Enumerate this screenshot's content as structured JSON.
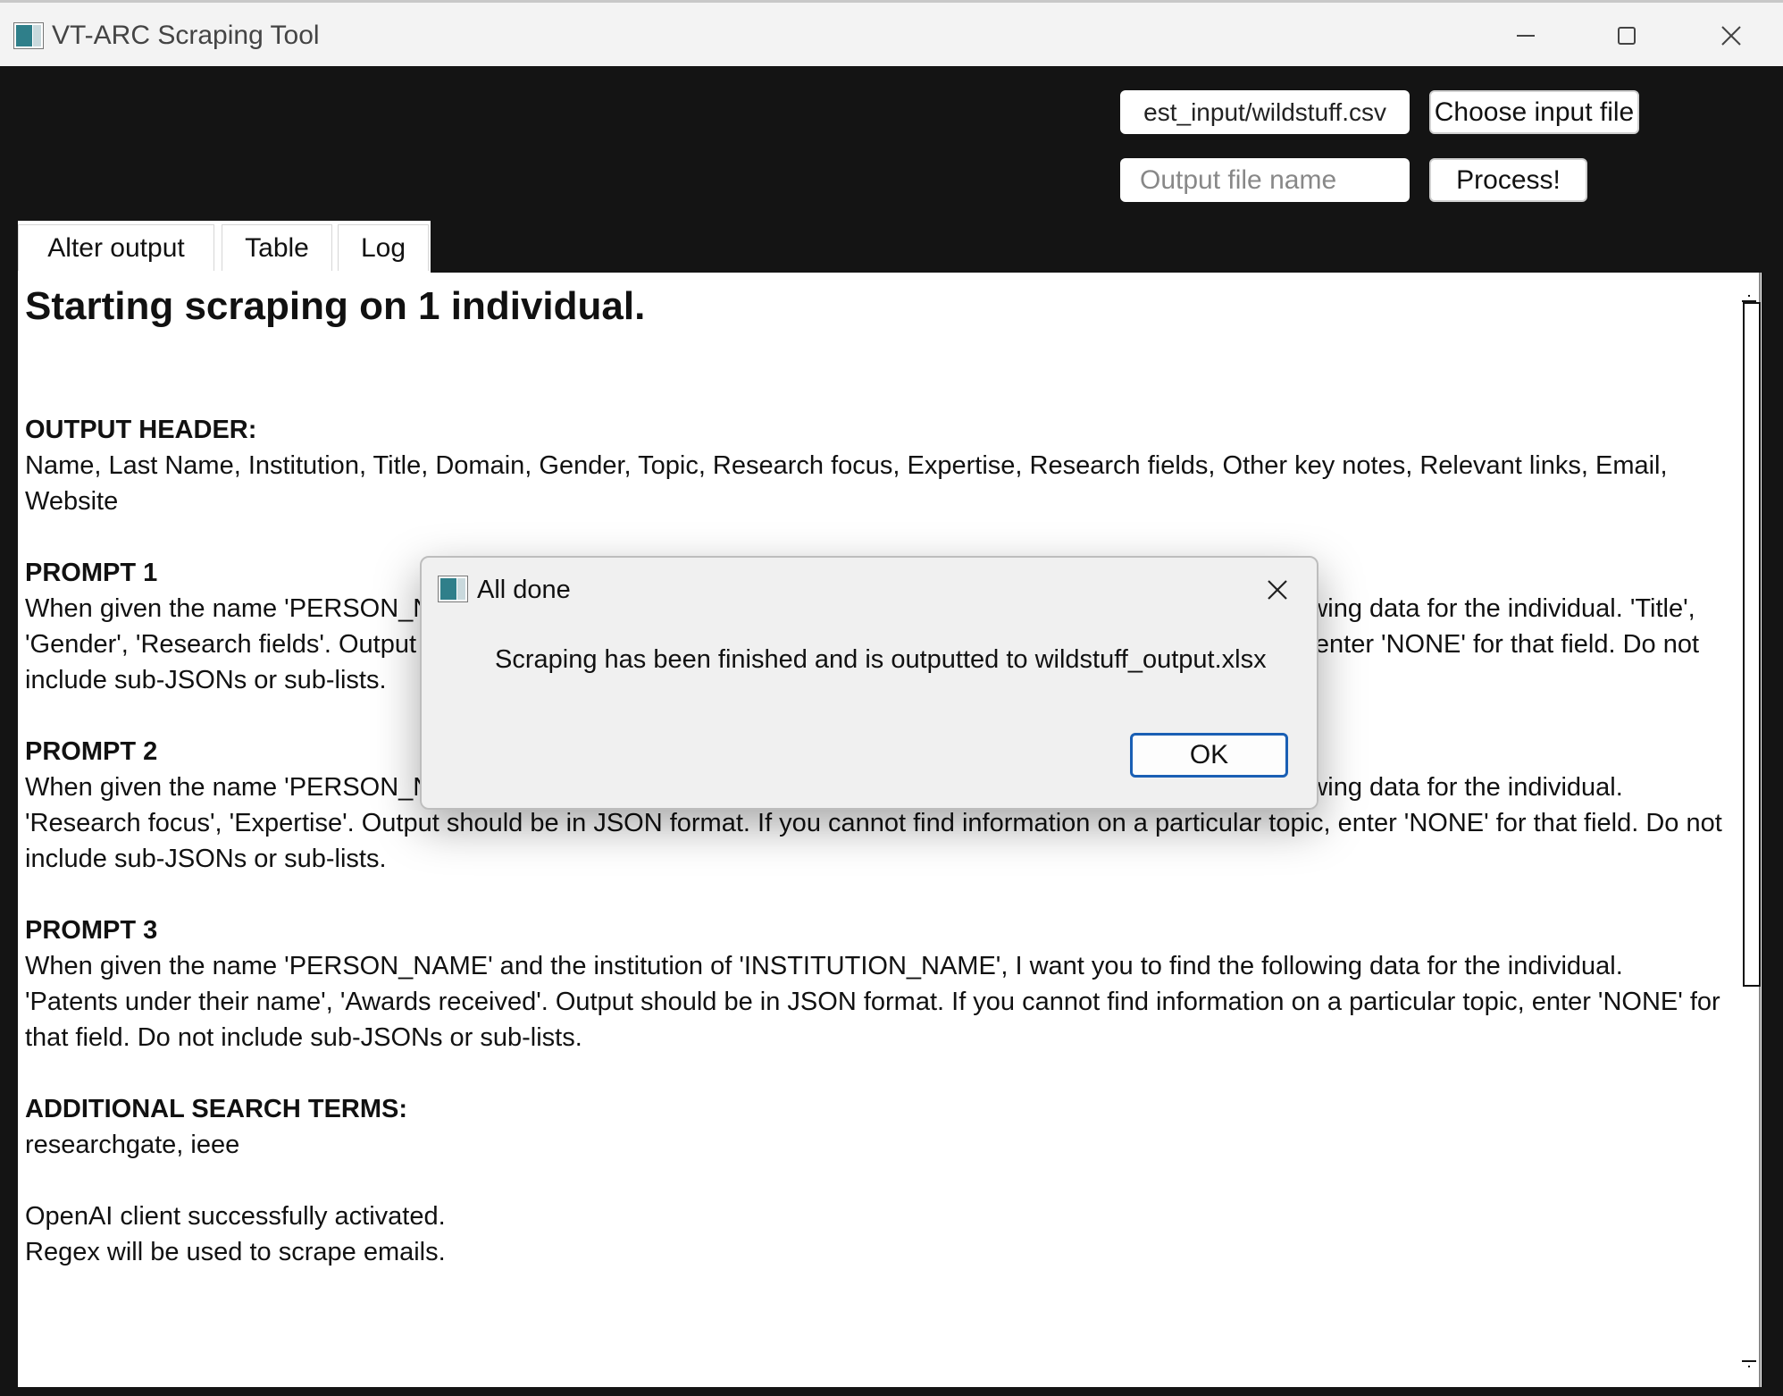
{
  "window": {
    "title": "VT-ARC Scraping Tool",
    "icons": {
      "app": "app-icon",
      "minimize": "minimize-icon",
      "maximize": "maximize-icon",
      "close": "close-icon"
    }
  },
  "controls": {
    "input_path_value": "est_input/wildstuff.csv",
    "choose_input_label": "Choose input file",
    "output_placeholder": "Output file name",
    "process_label": "Process!"
  },
  "tabs": [
    {
      "label": "Alter output"
    },
    {
      "label": "Table"
    },
    {
      "label": "Log"
    }
  ],
  "log": {
    "heading": "Starting scraping on 1 individual.",
    "output_header_label": "OUTPUT HEADER:",
    "output_header_text": "Name, Last Name, Institution, Title, Domain, Gender, Topic, Research focus, Expertise, Research fields, Other key notes, Relevant links, Email, Website",
    "prompt1_label": "PROMPT 1",
    "prompt1_text": "When given the name 'PERSON_NAME' and the institution of 'INSTITUTION_NAME', I want you to find the following data for the individual. 'Title', 'Gender', 'Research fields'. Output should be in JSON format. If you cannot find information on a particular topic, enter 'NONE' for that field. Do not include sub-JSONs or sub-lists.",
    "prompt2_label": "PROMPT 2",
    "prompt2_text": "When given the name 'PERSON_NAME' and the institution of 'INSTITUTION_NAME', I want you to find the following data for the individual. 'Research focus', 'Expertise'. Output should be in JSON format. If you cannot find information on a particular topic, enter 'NONE' for that field. Do not include sub-JSONs or sub-lists.",
    "prompt3_label": "PROMPT 3",
    "prompt3_text": "When given the name 'PERSON_NAME' and the institution of 'INSTITUTION_NAME', I want you to find the following data for the individual. 'Patents under their name', 'Awards received'. Output should be in JSON format. If you cannot find information on a particular topic, enter 'NONE' for that field. Do not include sub-JSONs or sub-lists.",
    "search_terms_label": "ADDITIONAL SEARCH TERMS:",
    "search_terms_text": "researchgate, ieee",
    "status_line_1": "OpenAI client successfully activated.",
    "status_line_2": "Regex will be used to scrape emails."
  },
  "dialog": {
    "title": "All done",
    "message": "Scraping has been finished and is outputted to wildstuff_output.xlsx",
    "ok_label": "OK"
  }
}
